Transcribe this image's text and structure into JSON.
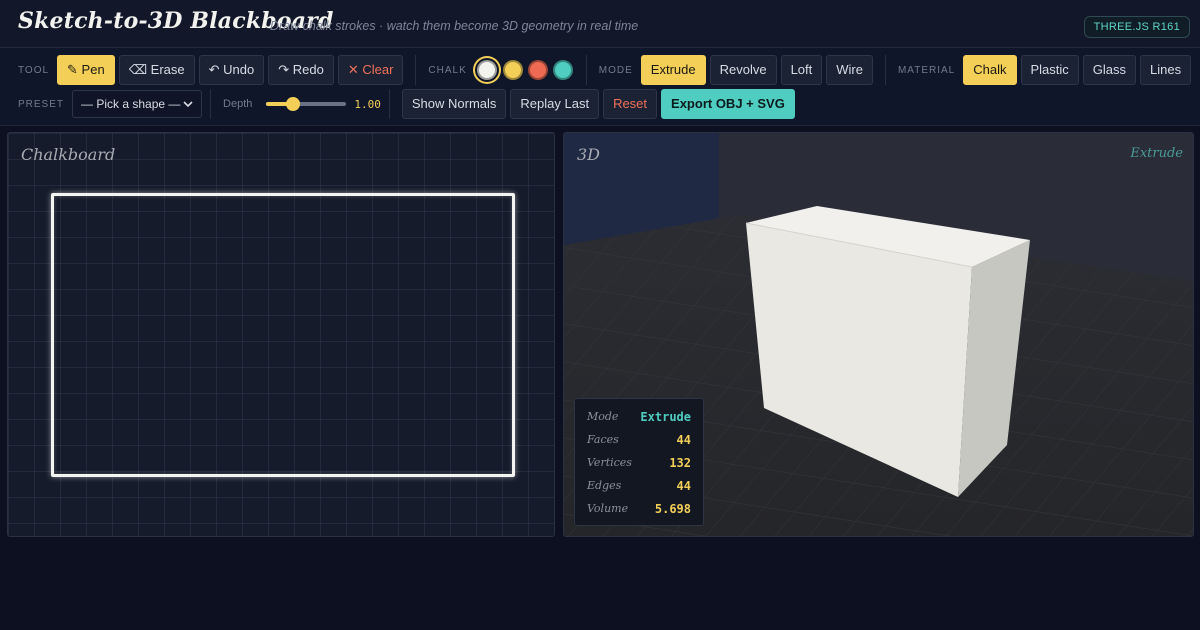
{
  "header": {
    "title": "Sketch-to-3D Blackboard",
    "subtitle": "Draw chalk strokes · watch them become 3D geometry in real time",
    "badge": "THREE.JS R161"
  },
  "toolbar": {
    "tool_label": "TOOL",
    "tools": {
      "pen": "✎ Pen",
      "erase": "⌫ Erase",
      "undo": "↶ Undo",
      "redo": "↷ Redo",
      "clear": "✕ Clear"
    },
    "chalk_label": "CHALK",
    "chalk_colors": [
      "#f4f4ee",
      "#f3cf58",
      "#ee6a52",
      "#4ecdc0"
    ],
    "mode_label": "MODE",
    "modes": {
      "extrude": "Extrude",
      "revolve": "Revolve",
      "loft": "Loft",
      "wire": "Wire"
    },
    "material_label": "MATERIAL",
    "materials": {
      "chalk": "Chalk",
      "plastic": "Plastic",
      "glass": "Glass",
      "lines": "Lines"
    },
    "preset_label": "PRESET",
    "preset_value": "— Pick a shape —",
    "depth_label": "Depth",
    "depth_value": "1.00",
    "depth_fraction": 0.33,
    "actions": {
      "show_normals": "Show Normals",
      "replay_last": "Replay Last",
      "reset": "Reset",
      "export": "Export OBJ + SVG"
    }
  },
  "chalkboard": {
    "title": "Chalkboard"
  },
  "viewport": {
    "title": "3D",
    "mode_tag": "Extrude",
    "stats": {
      "mode_label": "Mode",
      "mode_value": "Extrude",
      "faces_label": "Faces",
      "faces_value": "44",
      "vertices_label": "Vertices",
      "vertices_value": "132",
      "edges_label": "Edges",
      "edges_value": "44",
      "volume_label": "Volume",
      "volume_value": "5.698"
    }
  }
}
